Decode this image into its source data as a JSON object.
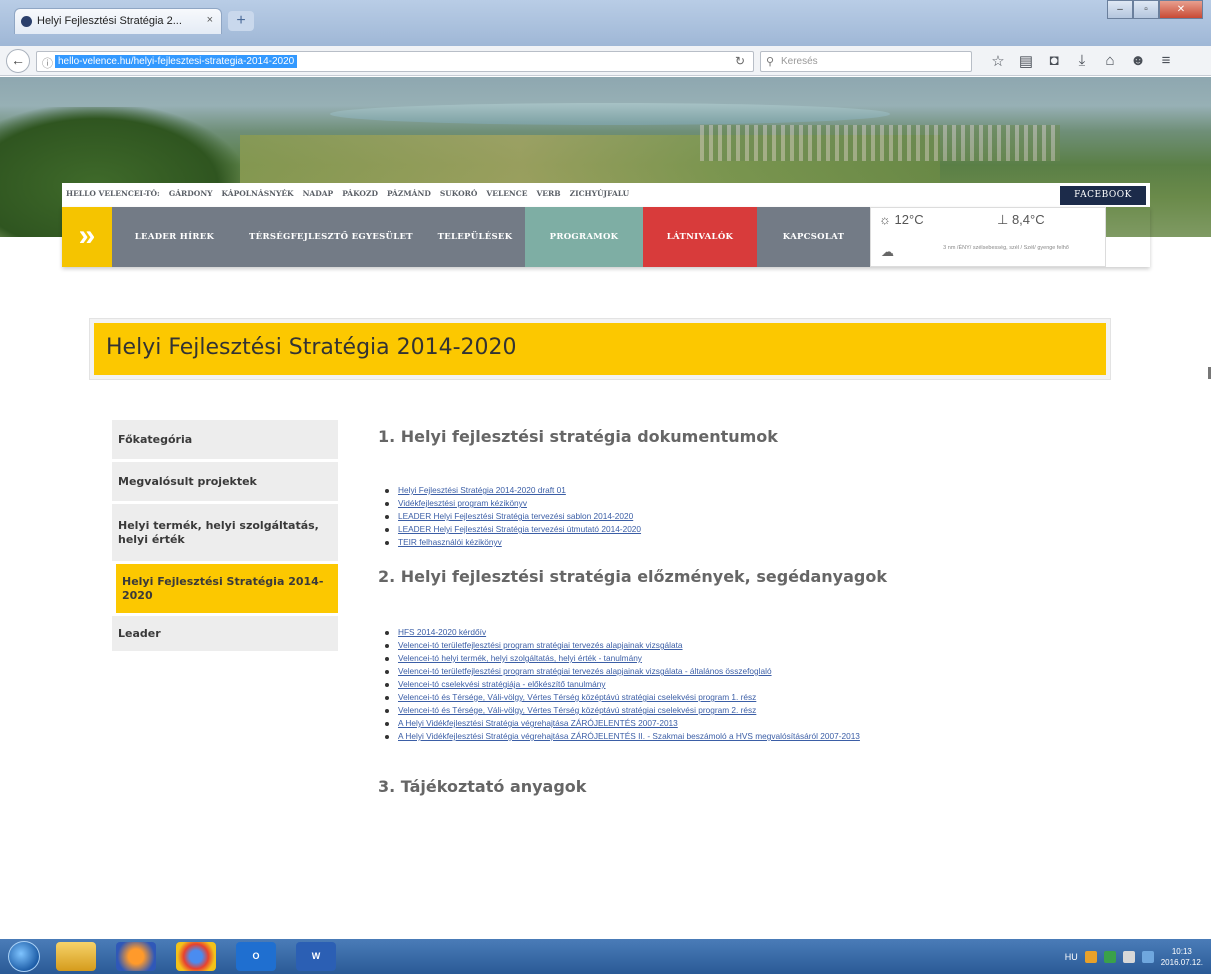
{
  "browser": {
    "tab_title": "Helyi Fejlesztési Stratégia 2...",
    "tab_close": "×",
    "new_tab": "+",
    "url": "hello-velence.hu/helyi-fejlesztesi-strategia-2014-2020",
    "search_placeholder": "Keresés",
    "toolbar_icons": [
      "star-icon",
      "library-icon",
      "pocket-icon",
      "download-icon",
      "home-icon",
      "extension-icon",
      "menu-icon"
    ]
  },
  "site": {
    "towns_bar": [
      "HELLO VELENCEI-TÓ:",
      "GÁRDONY",
      "KÁPOLNÁSNYÉK",
      "NADAP",
      "PÁKOZD",
      "PÁZMÁND",
      "SUKORÓ",
      "VELENCE",
      "VERB",
      "ZICHYÚJFALU"
    ],
    "facebook_label": "FACEBOOK",
    "main_nav": [
      {
        "label": "LEADER HÍREK",
        "color": "gray"
      },
      {
        "label": "TÉRSÉGFEJLESZTŐ EGYESÜLET",
        "color": "gray"
      },
      {
        "label": "TELEPÜLÉSEK",
        "color": "gray"
      },
      {
        "label": "PROGRAMOK",
        "color": "teal"
      },
      {
        "label": "LÁTNIVALÓK",
        "color": "red"
      },
      {
        "label": "KAPCSOLAT",
        "color": "gray"
      }
    ],
    "weather": {
      "air_temp": "12°C",
      "water_temp": "8,4°C",
      "note": "3 nm /ÉNY/ szélsebesség, szél / Szél/ gyenge felhő"
    },
    "page_title": "Helyi Fejlesztési Stratégia 2014-2020",
    "sidebar": [
      {
        "label": "Főkategória",
        "active": false
      },
      {
        "label": "Megvalósult projektek",
        "active": false
      },
      {
        "label": "Helyi termék, helyi szolgáltatás, helyi érték",
        "active": false
      },
      {
        "label": "Helyi Fejlesztési Stratégia 2014-2020",
        "active": true
      },
      {
        "label": "Leader",
        "active": false
      }
    ],
    "sections": [
      {
        "heading": "1. Helyi fejlesztési stratégia dokumentumok",
        "links": [
          "Helyi Fejlesztési Stratégia 2014-2020 draft 01",
          "Vidékfejlesztési program kézikönyv",
          "LEADER Helyi Fejlesztési Stratégia tervezési sablon 2014-2020",
          "LEADER Helyi Fejlesztési Stratégia tervezési útmutató 2014-2020",
          "TEIR felhasználói kézikönyv"
        ]
      },
      {
        "heading": "2. Helyi fejlesztési stratégia előzmények, segédanyagok",
        "links": [
          "HFS 2014-2020 kérdőív",
          "Velencei-tó területfejlesztési program stratégiai tervezés alapjainak vizsgálata",
          "Velencei-tó helyi termék, helyi szolgáltatás, helyi érték - tanulmány",
          "Velencei-tó területfejlesztési program stratégiai tervezés alapjainak vizsgálata - általános összefoglaló",
          "Velencei-tó cselekvési stratégiája - előkészítő tanulmány",
          "Velencei-tó és Térsége, Váli-völgy, Vértes Térség középtávú stratégiai cselekvési program 1. rész",
          "Velencei-tó és Térsége, Váli-völgy, Vértes Térség középtávú stratégiai cselekvési program 2. rész",
          "A Helyi Vidékfejlesztési Stratégia végrehajtása ZÁRÓJELENTÉS 2007-2013",
          "A Helyi Vidékfejlesztési Stratégia végrehajtása ZÁRÓJELENTÉS II. - Szakmai beszámoló a HVS megvalósításáról 2007-2013"
        ]
      },
      {
        "heading": "3. Tájékoztató anyagok",
        "links": []
      }
    ]
  },
  "taskbar": {
    "apps": [
      "explorer-icon",
      "firefox-icon",
      "chrome-icon",
      "outlook-icon",
      "word-icon"
    ],
    "outlook_label": "O",
    "word_label": "W",
    "lang": "HU",
    "time": "10:13",
    "date": "2016.07.12."
  },
  "colors": {
    "accent_yellow": "#fcc800",
    "nav_gray": "#737b86",
    "nav_teal": "#7eaea4",
    "nav_red": "#d83b3b",
    "facebook_navy": "#1c2b4a",
    "link_blue": "#3b5ea6"
  }
}
